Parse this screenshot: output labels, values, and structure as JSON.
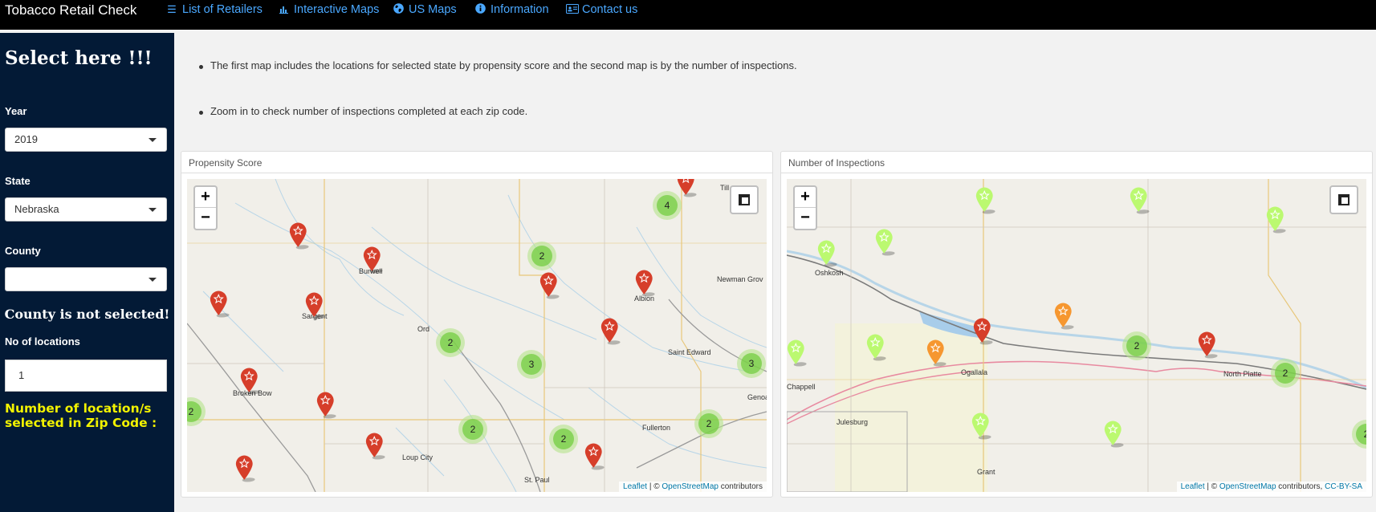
{
  "navbar": {
    "brand": "Tobacco Retail Check",
    "items": [
      {
        "label": "List of Retailers",
        "icon": "list-icon"
      },
      {
        "label": "Interactive Maps",
        "icon": "bar-chart-icon"
      },
      {
        "label": "US Maps",
        "icon": "globe-icon"
      },
      {
        "label": "Information",
        "icon": "info-circle-icon"
      },
      {
        "label": "Contact us",
        "icon": "address-card-icon"
      }
    ]
  },
  "sidebar": {
    "title": "Select here !!!",
    "year_label": "Year",
    "year_value": "2019",
    "state_label": "State",
    "state_value": "Nebraska",
    "county_label": "County",
    "county_value": "",
    "county_message": "County is not selected!",
    "locations_label": "No of locations",
    "locations_value": "1",
    "zip_message": "Number of location/s selected in Zip Code :"
  },
  "info": {
    "bullets": [
      "The first map includes the locations for selected state by propensity score and the second map is by the number of inspections.",
      "Zoom in to check number of inspections completed at each zip code."
    ]
  },
  "panels": {
    "propensity": {
      "title": "Propensity Score",
      "zoom_in": "+",
      "zoom_out": "−",
      "towns": [
        "Burwell",
        "Sargent",
        "Broken Bow",
        "Ord",
        "Loup City",
        "St. Paul",
        "Albion",
        "Newman Grov",
        "Saint Edward",
        "Fullerton",
        "Genoa",
        "Till"
      ],
      "clusters": [
        "4",
        "2",
        "2",
        "3",
        "3",
        "2",
        "2",
        "2",
        "2"
      ],
      "attribution": {
        "leaflet": "Leaflet",
        "sep": " | © ",
        "osm": "OpenStreetMap",
        "suffix": " contributors"
      }
    },
    "inspections": {
      "title": "Number of Inspections",
      "zoom_in": "+",
      "zoom_out": "−",
      "towns": [
        "Oshkosh",
        "Ogallala",
        "North Platte",
        "Julesburg",
        "Chappell",
        "Grant"
      ],
      "clusters": [
        "2",
        "2",
        "2"
      ],
      "attribution": {
        "leaflet": "Leaflet",
        "sep": " | © ",
        "osm": "OpenStreetMap",
        "suffix": " contributors, ",
        "license": "CC-BY-SA"
      }
    }
  },
  "colors": {
    "pin_red": "#d63e2a",
    "pin_lightgreen": "#bbf970",
    "pin_orange": "#f69730",
    "navbar_link": "#4aa8ff",
    "sidebar_bg": "#031a36",
    "zip_message": "#f2f200"
  }
}
